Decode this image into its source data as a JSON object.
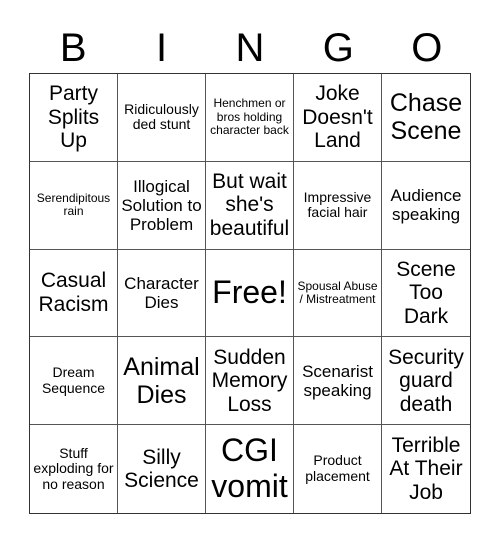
{
  "header": {
    "letters": [
      "B",
      "I",
      "N",
      "G",
      "O"
    ]
  },
  "cells": [
    [
      "Party Splits Up",
      "Ridiculously ded stunt",
      "Henchmen or bros holding character back",
      "Joke Doesn't Land",
      "Chase Scene"
    ],
    [
      "Serendipitous rain",
      "Illogical Solution to Problem",
      "But wait she's beautiful",
      "Impressive facial hair",
      "Audience speaking"
    ],
    [
      "Casual Racism",
      "Character Dies",
      "Free!",
      "Spousal Abuse / Mistreatment",
      "Scene Too Dark"
    ],
    [
      "Dream Sequence",
      "Animal Dies",
      "Sudden Memory Loss",
      "Scenarist speaking",
      "Security guard death"
    ],
    [
      "Stuff exploding for no reason",
      "Silly Science",
      "CGI vomit",
      "Product placement",
      "Terrible At Their Job"
    ]
  ]
}
